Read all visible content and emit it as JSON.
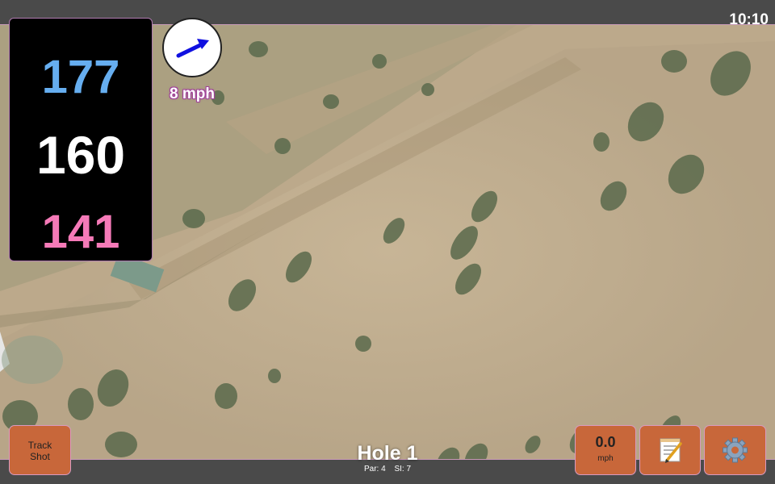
{
  "status_bar": {
    "time": "10:10"
  },
  "distances": {
    "back": "177",
    "middle": "160",
    "front": "141",
    "colors": {
      "back": "#66aef0",
      "middle": "#ffffff",
      "front": "#f57ab8"
    }
  },
  "wind": {
    "speed_label": "8 mph",
    "arrow_icon": "arrow-right-icon",
    "arrow_color": "#1010e0"
  },
  "hole": {
    "title": "Hole 1",
    "par": "Par: 4",
    "stroke_index": "SI: 7"
  },
  "buttons": {
    "track_shot": [
      "Track",
      "Shot"
    ],
    "speed_value": "0.0",
    "speed_unit": "mph",
    "notes_icon": "notepad-icon",
    "settings_icon": "gear-icon"
  },
  "colors": {
    "button": "#c8673a",
    "accent_border": "#d99ac0",
    "bar": "#4a4a4a"
  }
}
